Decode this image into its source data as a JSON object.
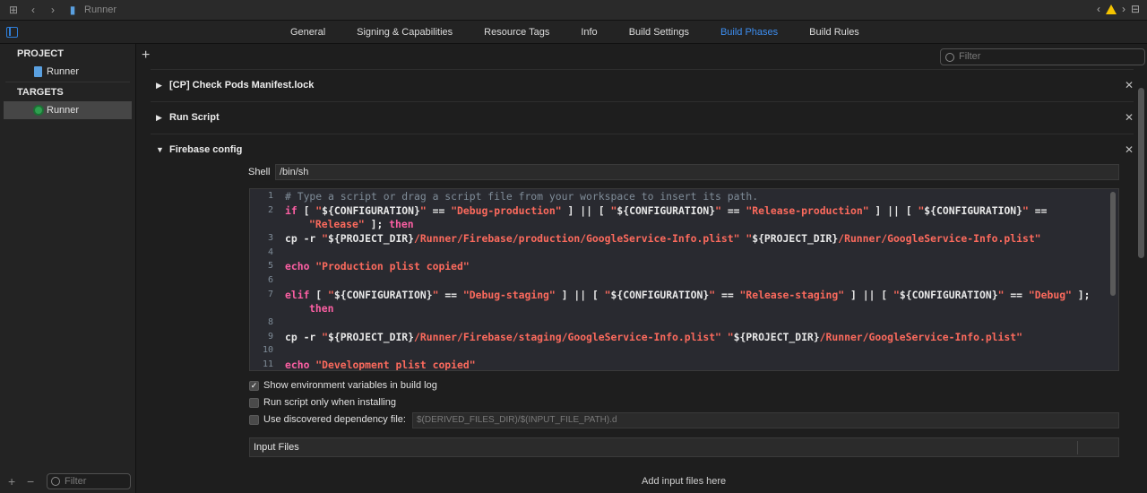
{
  "topbar": {
    "crumb": "Runner"
  },
  "tabs": [
    {
      "label": "General"
    },
    {
      "label": "Signing & Capabilities"
    },
    {
      "label": "Resource Tags"
    },
    {
      "label": "Info"
    },
    {
      "label": "Build Settings"
    },
    {
      "label": "Build Phases",
      "active": true
    },
    {
      "label": "Build Rules"
    }
  ],
  "sidebar": {
    "project_header": "PROJECT",
    "project_item": "Runner",
    "targets_header": "TARGETS",
    "target_item": "Runner",
    "filter_placeholder": "Filter"
  },
  "main": {
    "filter_placeholder": "Filter",
    "phases": [
      {
        "title": "[CP] Check Pods Manifest.lock"
      },
      {
        "title": "Run Script"
      },
      {
        "title": "Firebase config"
      }
    ],
    "shell_label": "Shell",
    "shell_value": "/bin/sh",
    "code_lines": [
      {
        "n": "1",
        "text": "# Type a script or drag a script file from your workspace to insert its path."
      },
      {
        "n": "2",
        "text": "if [ \"${CONFIGURATION}\" == \"Debug-production\" ] || [ \"${CONFIGURATION}\" == \"Release-production\" ] || [ \"${CONFIGURATION}\" =="
      },
      {
        "n": "",
        "text": "\"Release\" ]; then"
      },
      {
        "n": "3",
        "text": "cp -r \"${PROJECT_DIR}/Runner/Firebase/production/GoogleService-Info.plist\" \"${PROJECT_DIR}/Runner/GoogleService-Info.plist\""
      },
      {
        "n": "4",
        "text": ""
      },
      {
        "n": "5",
        "text": "echo \"Production plist copied\""
      },
      {
        "n": "6",
        "text": ""
      },
      {
        "n": "7",
        "text": "elif [ \"${CONFIGURATION}\" == \"Debug-staging\" ] || [ \"${CONFIGURATION}\" == \"Release-staging\" ] || [ \"${CONFIGURATION}\" == \"Debug\" ];"
      },
      {
        "n": "",
        "text": "then"
      },
      {
        "n": "8",
        "text": ""
      },
      {
        "n": "9",
        "text": "cp -r \"${PROJECT_DIR}/Runner/Firebase/staging/GoogleService-Info.plist\" \"${PROJECT_DIR}/Runner/GoogleService-Info.plist\""
      },
      {
        "n": "10",
        "text": ""
      },
      {
        "n": "11",
        "text": "echo \"Development plist copied\""
      }
    ],
    "options": {
      "show_env": {
        "label": "Show environment variables in build log",
        "checked": true
      },
      "run_only_installing": {
        "label": "Run script only when installing",
        "checked": false
      },
      "use_dep_file": {
        "label": "Use discovered dependency file:",
        "checked": false
      }
    },
    "dep_file_placeholder": "$(DERIVED_FILES_DIR)/$(INPUT_FILE_PATH).d",
    "input_files_title": "Input Files",
    "add_input_files": "Add input files here"
  },
  "colors": {
    "accent": "#3d8ef0",
    "keyword": "#fc5fa3",
    "string": "#fc6a5d",
    "comment": "#7f8c98"
  }
}
